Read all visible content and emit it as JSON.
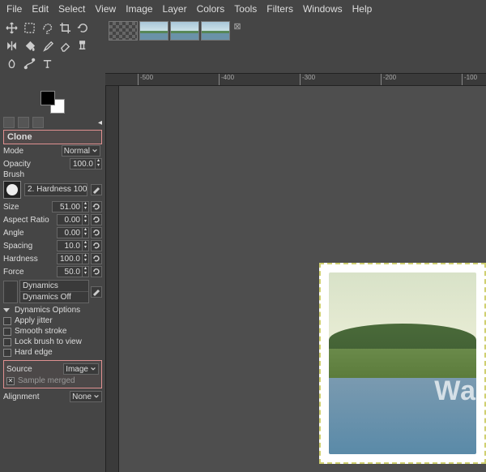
{
  "menubar": [
    "File",
    "Edit",
    "Select",
    "View",
    "Image",
    "Layer",
    "Colors",
    "Tools",
    "Filters",
    "Windows",
    "Help"
  ],
  "ruler_ticks": [
    {
      "pos": 40,
      "label": "-500"
    },
    {
      "pos": 140,
      "label": "-400"
    },
    {
      "pos": 240,
      "label": "-300"
    },
    {
      "pos": 340,
      "label": "-200"
    },
    {
      "pos": 440,
      "label": "-100"
    }
  ],
  "tool": {
    "title": "Clone",
    "mode_label": "Mode",
    "mode_value": "Normal",
    "opacity_label": "Opacity",
    "opacity_value": "100.0",
    "brush_label": "Brush",
    "brush_name": "2. Hardness 100",
    "size_label": "Size",
    "size_value": "51.00",
    "aspect_label": "Aspect Ratio",
    "aspect_value": "0.00",
    "angle_label": "Angle",
    "angle_value": "0.00",
    "spacing_label": "Spacing",
    "spacing_value": "10.0",
    "hardness_label": "Hardness",
    "hardness_value": "100.0",
    "force_label": "Force",
    "force_value": "50.0",
    "dynamics_label": "Dynamics",
    "dynamics_value": "Dynamics Off",
    "dynamics_options": "Dynamics Options",
    "jitter": "Apply jitter",
    "smooth": "Smooth stroke",
    "lock": "Lock brush to view",
    "hard": "Hard edge",
    "source_label": "Source",
    "source_value": "Image",
    "sample_merged": "Sample merged",
    "alignment_label": "Alignment",
    "alignment_value": "None"
  },
  "watermark": "Wa"
}
